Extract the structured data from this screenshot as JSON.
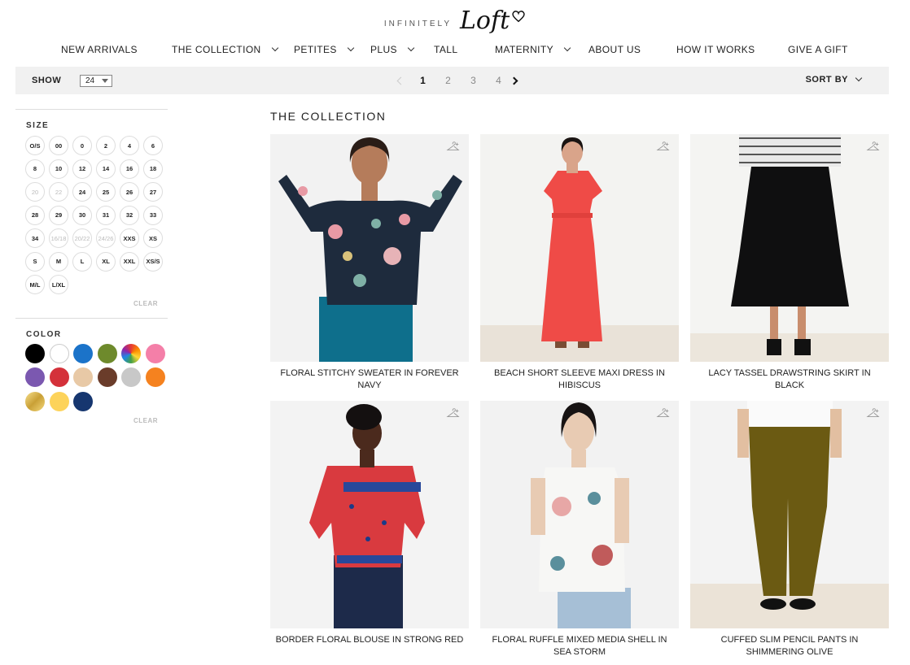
{
  "brand": {
    "prefix": "INFINITELY",
    "logo": "Loft"
  },
  "nav": [
    {
      "label": "NEW ARRIVALS",
      "dropdown": false
    },
    {
      "label": "THE COLLECTION",
      "dropdown": true
    },
    {
      "label": "PETITES",
      "dropdown": true
    },
    {
      "label": "PLUS",
      "dropdown": true
    },
    {
      "label": "TALL",
      "dropdown": false
    },
    {
      "label": "MATERNITY",
      "dropdown": true
    },
    {
      "label": "ABOUT US",
      "dropdown": false
    },
    {
      "label": "HOW IT WORKS",
      "dropdown": false
    },
    {
      "label": "GIVE A GIFT",
      "dropdown": false
    }
  ],
  "toolbar": {
    "show_label": "SHOW",
    "show_value": "24",
    "pages": [
      "1",
      "2",
      "3",
      "4"
    ],
    "current_page": "1",
    "sort_label": "SORT BY"
  },
  "filters": {
    "size_title": "SIZE",
    "sizes": [
      {
        "label": "O/S",
        "available": true
      },
      {
        "label": "00",
        "available": true
      },
      {
        "label": "0",
        "available": true
      },
      {
        "label": "2",
        "available": true
      },
      {
        "label": "4",
        "available": true
      },
      {
        "label": "6",
        "available": true
      },
      {
        "label": "8",
        "available": true
      },
      {
        "label": "10",
        "available": true
      },
      {
        "label": "12",
        "available": true
      },
      {
        "label": "14",
        "available": true
      },
      {
        "label": "16",
        "available": true
      },
      {
        "label": "18",
        "available": true
      },
      {
        "label": "20",
        "available": false
      },
      {
        "label": "22",
        "available": false
      },
      {
        "label": "24",
        "available": true
      },
      {
        "label": "25",
        "available": true
      },
      {
        "label": "26",
        "available": true
      },
      {
        "label": "27",
        "available": true
      },
      {
        "label": "28",
        "available": true
      },
      {
        "label": "29",
        "available": true
      },
      {
        "label": "30",
        "available": true
      },
      {
        "label": "31",
        "available": true
      },
      {
        "label": "32",
        "available": true
      },
      {
        "label": "33",
        "available": true
      },
      {
        "label": "34",
        "available": true
      },
      {
        "label": "16/18",
        "available": false
      },
      {
        "label": "20/22",
        "available": false
      },
      {
        "label": "24/26",
        "available": false
      },
      {
        "label": "XXS",
        "available": true
      },
      {
        "label": "XS",
        "available": true
      },
      {
        "label": "S",
        "available": true
      },
      {
        "label": "M",
        "available": true
      },
      {
        "label": "L",
        "available": true
      },
      {
        "label": "XL",
        "available": true
      },
      {
        "label": "XXL",
        "available": true
      },
      {
        "label": "XS/S",
        "available": true
      },
      {
        "label": "M/L",
        "available": true
      },
      {
        "label": "L/XL",
        "available": true
      }
    ],
    "color_title": "COLOR",
    "colors": [
      {
        "name": "black",
        "value": "#000000"
      },
      {
        "name": "white",
        "value": "#ffffff"
      },
      {
        "name": "blue",
        "value": "#1b73c9"
      },
      {
        "name": "green",
        "value": "#6e8a2c"
      },
      {
        "name": "multi",
        "value": "rainbow"
      },
      {
        "name": "pink",
        "value": "#f47fa8"
      },
      {
        "name": "purple",
        "value": "#7b58b0"
      },
      {
        "name": "red",
        "value": "#d4313a"
      },
      {
        "name": "beige",
        "value": "#e8c9a6"
      },
      {
        "name": "brown",
        "value": "#6a3c2a"
      },
      {
        "name": "grey",
        "value": "#c8c8c8"
      },
      {
        "name": "orange",
        "value": "#f5821f"
      },
      {
        "name": "gold",
        "value": "gold-gradient"
      },
      {
        "name": "yellow",
        "value": "#fdd35a"
      },
      {
        "name": "navy",
        "value": "#16366f"
      }
    ],
    "clear_label": "CLEAR"
  },
  "main": {
    "section_title": "THE COLLECTION",
    "products": [
      {
        "name": "FLORAL STITCHY SWEATER IN FOREVER NAVY",
        "image": "model-floral-sweater"
      },
      {
        "name": "BEACH SHORT SLEEVE MAXI DRESS IN HIBISCUS",
        "image": "model-red-maxi-dress"
      },
      {
        "name": "LACY TASSEL DRAWSTRING SKIRT IN BLACK",
        "image": "model-black-skirt"
      },
      {
        "name": "BORDER FLORAL BLOUSE IN STRONG RED",
        "image": "model-red-blouse"
      },
      {
        "name": "FLORAL RUFFLE MIXED MEDIA SHELL IN SEA STORM",
        "image": "model-floral-shell"
      },
      {
        "name": "CUFFED SLIM PENCIL PANTS IN SHIMMERING OLIVE",
        "image": "model-olive-pants"
      }
    ]
  }
}
